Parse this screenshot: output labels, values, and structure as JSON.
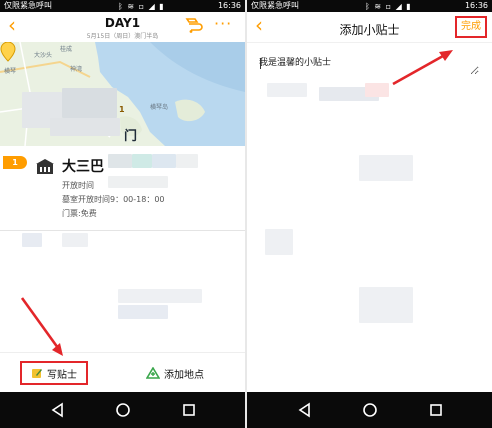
{
  "status_bar": {
    "carrier": "仅限紧急呼叫",
    "time": "16:36",
    "icons": [
      "bluetooth-icon",
      "wifi-icon",
      "no-sim-icon",
      "signal-icon",
      "battery-icon"
    ]
  },
  "itinerary": {
    "title": "DAY1",
    "subtitle": "5月15日（周日）澳门半岛",
    "map": {
      "labels": [
        "大沙头",
        "桂成",
        "神湾",
        "横琴",
        "门",
        "横琴岛"
      ],
      "pin_number": "1"
    },
    "poi": {
      "number": "1",
      "name": "大三巴",
      "open_time_label": "开放时间",
      "tomb_time": "墓室开放时间9：00-18：00",
      "ticket": "门票:免费"
    },
    "actions": {
      "write_tip_label": "写贴士",
      "add_location_label": "添加地点"
    }
  },
  "add_tip": {
    "title": "添加小贴士",
    "done_label": "完成",
    "text_value": "",
    "placeholder": "我是温馨的小贴士"
  },
  "colors": {
    "accent": "#ff9d00",
    "highlight_red": "#e3262a",
    "statusbar": "#0a0a0a",
    "sea": "#b9d8ef",
    "land": "#eaf1e2"
  }
}
